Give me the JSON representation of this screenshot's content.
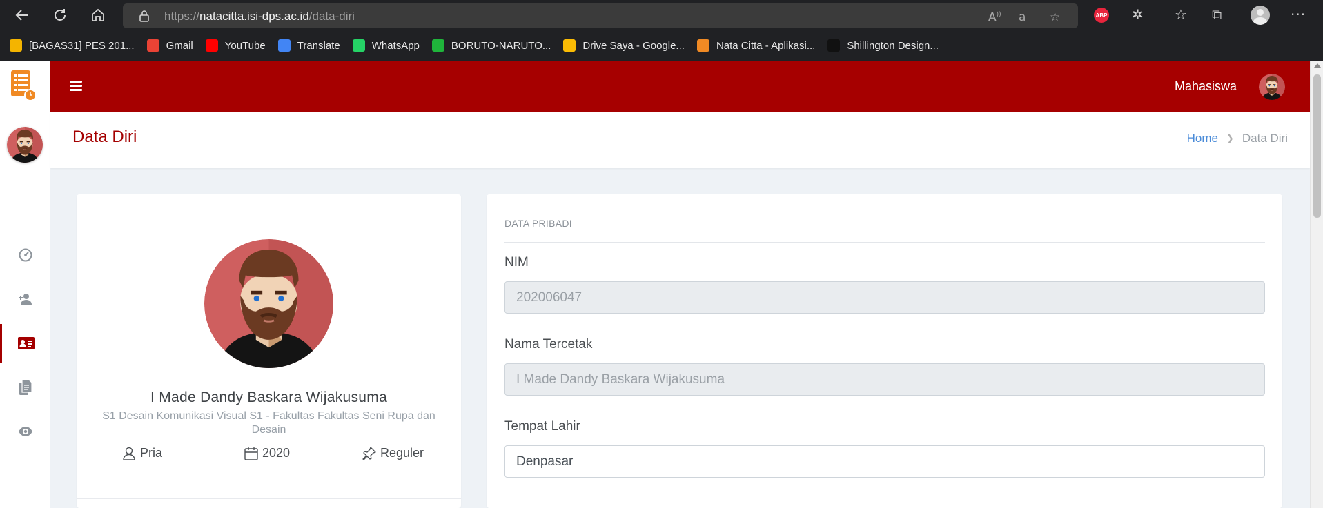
{
  "browser": {
    "url_prefix": "https://",
    "url_host": "natacitta.isi-dps.ac.id",
    "url_path": "/data-diri",
    "abp_label": "ABP",
    "bookmarks": [
      {
        "label": "[BAGAS31] PES 201...",
        "icon": "bagas31-icon",
        "color": "#f4b400"
      },
      {
        "label": "Gmail",
        "icon": "gmail-icon",
        "color": "#ea4335"
      },
      {
        "label": "YouTube",
        "icon": "youtube-icon",
        "color": "#ff0000"
      },
      {
        "label": "Translate",
        "icon": "translate-icon",
        "color": "#4285f4"
      },
      {
        "label": "WhatsApp",
        "icon": "whatsapp-icon",
        "color": "#25d366"
      },
      {
        "label": "BORUTO-NARUTO...",
        "icon": "boruto-icon",
        "color": "#1fb53b"
      },
      {
        "label": "Drive Saya - Google...",
        "icon": "drive-icon",
        "color": "#fbbc04"
      },
      {
        "label": "Nata Citta - Aplikasi...",
        "icon": "natacitta-icon",
        "color": "#f08a24"
      },
      {
        "label": "Shillington Design...",
        "icon": "shillington-icon",
        "color": "#111111"
      }
    ]
  },
  "app": {
    "brand_color": "#a60000",
    "role": "Mahasiswa",
    "page_title": "Data Diri",
    "breadcrumb": {
      "home": "Home",
      "current": "Data Diri"
    },
    "sidebar_items": [
      {
        "icon": "dashboard-icon"
      },
      {
        "icon": "user-plus-icon"
      },
      {
        "icon": "id-card-icon",
        "active": true
      },
      {
        "icon": "documents-icon"
      },
      {
        "icon": "eye-icon"
      }
    ]
  },
  "profile": {
    "name": "I Made Dandy Baskara Wijakusuma",
    "program": "S1 Desain Komunikasi Visual S1 - Fakultas Fakultas Seni Rupa dan Desain",
    "gender": "Pria",
    "year": "2020",
    "class_type": "Reguler"
  },
  "form": {
    "section_label": "DATA PRIBADI",
    "nim_label": "NIM",
    "nim_value": "202006047",
    "nama_label": "Nama Tercetak",
    "nama_value": "I Made Dandy Baskara Wijakusuma",
    "tempat_label": "Tempat Lahir",
    "tempat_value": "Denpasar"
  }
}
